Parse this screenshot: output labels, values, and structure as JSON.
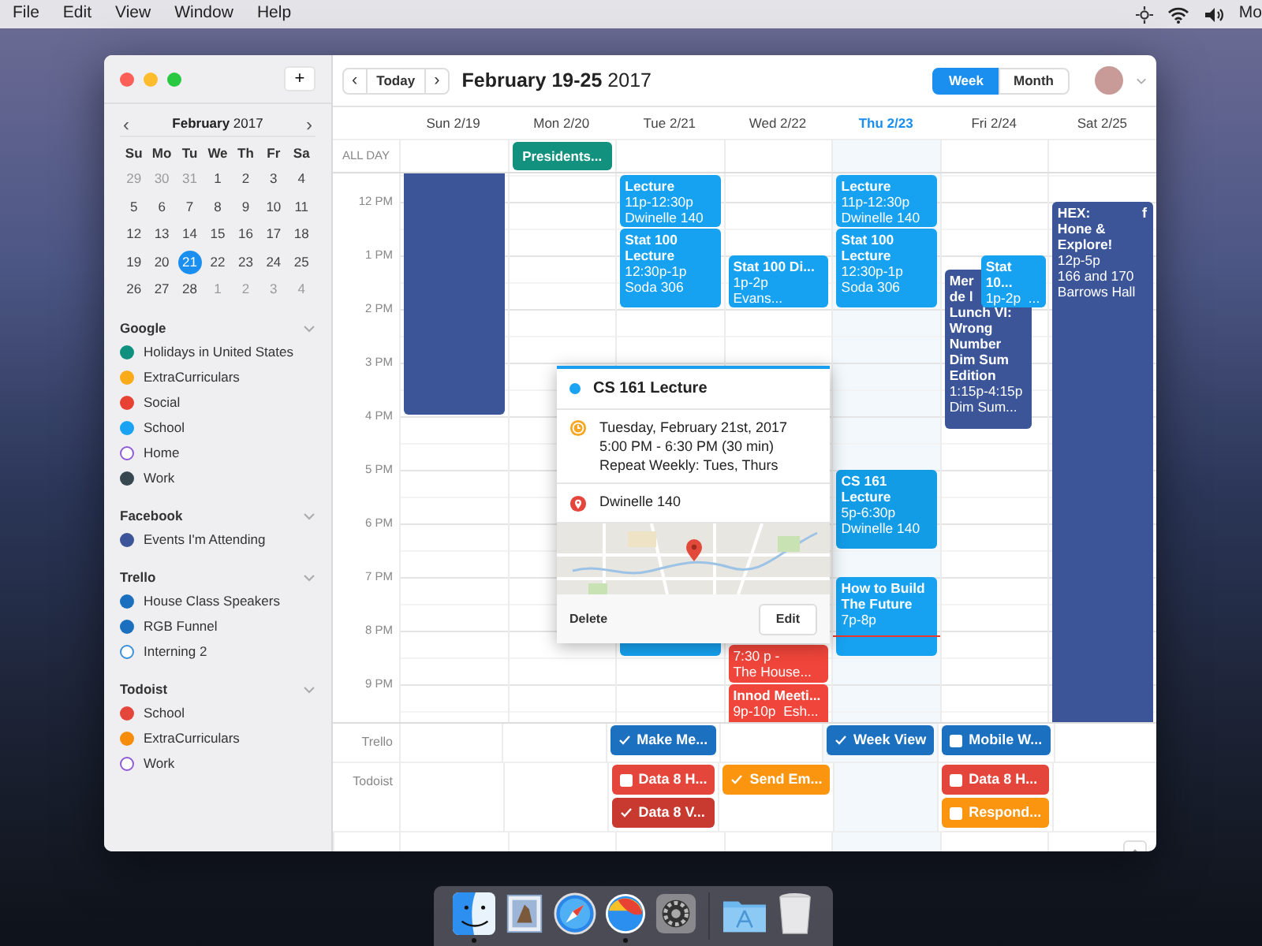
{
  "menu_bar": {
    "items": [
      "File",
      "Edit",
      "View",
      "Window",
      "Help"
    ],
    "status_text": "Mo"
  },
  "sidebar": {
    "add_button": "+",
    "mini_calendar": {
      "prev": "‹",
      "title": "**February** 2017",
      "next": "›",
      "weekdays": [
        "Su",
        "Mo",
        "Tu",
        "We",
        "Th",
        "Fr",
        "Sa"
      ],
      "weeks": [
        [
          {
            "day": "29",
            "muted": true,
            "selected": false
          },
          {
            "day": "30",
            "muted": true,
            "selected": false
          },
          {
            "day": "31",
            "muted": true,
            "selected": false
          },
          {
            "day": "1",
            "muted": false,
            "selected": false
          },
          {
            "day": "2",
            "muted": false,
            "selected": false
          },
          {
            "day": "3",
            "muted": false,
            "selected": false
          },
          {
            "day": "4",
            "muted": false,
            "selected": false
          }
        ],
        [
          {
            "day": "5",
            "muted": false,
            "selected": false
          },
          {
            "day": "6",
            "muted": false,
            "selected": false
          },
          {
            "day": "7",
            "muted": false,
            "selected": false
          },
          {
            "day": "8",
            "muted": false,
            "selected": false
          },
          {
            "day": "9",
            "muted": false,
            "selected": false
          },
          {
            "day": "10",
            "muted": false,
            "selected": false
          },
          {
            "day": "11",
            "muted": false,
            "selected": false
          }
        ],
        [
          {
            "day": "12",
            "muted": false,
            "selected": false
          },
          {
            "day": "13",
            "muted": false,
            "selected": false
          },
          {
            "day": "14",
            "muted": false,
            "selected": false
          },
          {
            "day": "15",
            "muted": false,
            "selected": false
          },
          {
            "day": "16",
            "muted": false,
            "selected": false
          },
          {
            "day": "17",
            "muted": false,
            "selected": false
          },
          {
            "day": "18",
            "muted": false,
            "selected": false
          }
        ],
        [
          {
            "day": "19",
            "muted": false,
            "selected": false
          },
          {
            "day": "20",
            "muted": false,
            "selected": false
          },
          {
            "day": "21",
            "muted": false,
            "selected": true
          },
          {
            "day": "22",
            "muted": false,
            "selected": false
          },
          {
            "day": "23",
            "muted": false,
            "selected": false
          },
          {
            "day": "24",
            "muted": false,
            "selected": false
          },
          {
            "day": "25",
            "muted": false,
            "selected": false
          }
        ],
        [
          {
            "day": "26",
            "muted": false,
            "selected": false
          },
          {
            "day": "27",
            "muted": false,
            "selected": false
          },
          {
            "day": "28",
            "muted": false,
            "selected": false
          },
          {
            "day": "1",
            "muted": true,
            "selected": false
          },
          {
            "day": "2",
            "muted": true,
            "selected": false
          },
          {
            "day": "3",
            "muted": true,
            "selected": false
          },
          {
            "day": "4",
            "muted": true,
            "selected": false
          }
        ]
      ]
    },
    "groups": [
      {
        "name": "Google",
        "expanded": true,
        "calendars": [
          {
            "name": "Holidays in United States",
            "color": "#10917f",
            "visible": true
          },
          {
            "name": "ExtraCurriculars",
            "color": "#f9ab1a",
            "visible": true
          },
          {
            "name": "Social",
            "color": "#e84235",
            "visible": true
          },
          {
            "name": "School",
            "color": "#1aa3f2",
            "visible": true
          },
          {
            "name": "Home",
            "color": "#8e5bd6",
            "visible": false
          },
          {
            "name": "Work",
            "color": "#37474f",
            "visible": true
          }
        ]
      },
      {
        "name": "Facebook",
        "expanded": true,
        "calendars": [
          {
            "name": "Events I'm Attending",
            "color": "#3b5598",
            "visible": true
          }
        ]
      },
      {
        "name": "Trello",
        "expanded": true,
        "calendars": [
          {
            "name": "House Class Speakers",
            "color": "#1b6fbf",
            "visible": true
          },
          {
            "name": "RGB Funnel",
            "color": "#1b6fbf",
            "visible": true
          },
          {
            "name": "Interning 2",
            "color": "#3a90d8",
            "visible": false
          }
        ]
      },
      {
        "name": "Todoist",
        "expanded": true,
        "calendars": [
          {
            "name": "School",
            "color": "#e5463c",
            "visible": true
          },
          {
            "name": "ExtraCurriculars",
            "color": "#f58c0a",
            "visible": true
          },
          {
            "name": "Work",
            "color": "#8e5bd6",
            "visible": false
          }
        ]
      }
    ]
  },
  "toolbar": {
    "prev": "‹",
    "today": "Today",
    "next": "›",
    "title": "**February 19-25** 2017",
    "views": [
      {
        "label": "Week",
        "selected": true
      },
      {
        "label": "Month",
        "selected": false
      }
    ]
  },
  "week": {
    "all_day_label": "ALL DAY",
    "hours": [
      "12 PM",
      "1 PM",
      "2 PM",
      "3 PM",
      "4 PM",
      "5 PM",
      "6 PM",
      "7 PM",
      "8 PM",
      "9 PM"
    ],
    "days": [
      {
        "label": "Sun 2/19",
        "today": false,
        "events": [
          {
            "color": "#3b5598"
          }
        ]
      },
      {
        "label": "Mon 2/20",
        "today": false,
        "all_day": [
          {
            "title": "Presidents...",
            "color": "#12917f"
          }
        ]
      },
      {
        "label": "Tue 2/21",
        "today": false,
        "events": [
          {
            "title": "Lecture",
            "details": [
              "11p-12:30p",
              "Dwinelle 140"
            ],
            "color": "#16a2f0"
          },
          {
            "title": "Stat 100 Lecture",
            "details": [
              "12:30p-1p",
              "Soda 306"
            ],
            "color": "#16a2f0"
          },
          {
            "color": "#16a2f0"
          }
        ],
        "tasks": [
          {
            "kind": "trello",
            "title": "Make Me...",
            "checked": true,
            "color": "#1b70c0"
          },
          {
            "kind": "todoist",
            "title": "Data 8 H...",
            "checked": false,
            "color": "#e5463c"
          },
          {
            "kind": "todoist",
            "title": "Data 8 V...",
            "checked": true,
            "color": "#c8392f"
          }
        ]
      },
      {
        "label": "Wed 2/22",
        "today": false,
        "events": [
          {
            "title": "Stat 100 Di...",
            "details": [
              "1p-2p  Evans..."
            ],
            "color": "#16a2f0"
          },
          {
            "details": [
              "7:30 p -",
              "The House..."
            ],
            "color": "#f0453a"
          },
          {
            "title": "Innod Meeti...",
            "details": [
              "9p-10p  Esh..."
            ],
            "color": "#f0453a"
          }
        ],
        "tasks": [
          {
            "kind": "todoist",
            "title": "Send Em...",
            "checked": true,
            "color": "#fb9510"
          }
        ]
      },
      {
        "label": "Thu 2/23",
        "today": true,
        "now_line": true,
        "events": [
          {
            "title": "Lecture",
            "details": [
              "11p-12:30p",
              "Dwinelle 140"
            ],
            "color": "#16a2f0"
          },
          {
            "title": "Stat 100 Lecture",
            "details": [
              "12:30p-1p",
              "Soda 306"
            ],
            "color": "#16a2f0"
          },
          {
            "title": "CS 161 Lecture",
            "details": [
              "5p-6:30p",
              "Dwinelle 140"
            ],
            "color": "#129ce6"
          },
          {
            "title": "How to Build The Future",
            "details": [
              "7p-8p"
            ],
            "color": "#16a2f0"
          }
        ],
        "tasks": [
          {
            "kind": "trello",
            "title": "Week View",
            "checked": true,
            "color": "#1b70c0"
          }
        ]
      },
      {
        "label": "Fri 2/24",
        "today": false,
        "events": [
          {
            "title": "Stat 10...",
            "details": [
              "1p-2p  ..."
            ],
            "color": "#16a2f0"
          },
          {
            "title_start": "Mer de l",
            "title": "Lunch VI: Wrong Number Dim Sum Edition",
            "details": [
              "1:15p-4:15p",
              "Dim Sum..."
            ],
            "color": "#3b5598"
          }
        ],
        "tasks": [
          {
            "kind": "trello",
            "title": "Mobile W...",
            "checked": false,
            "color": "#1b70c0"
          },
          {
            "kind": "todoist",
            "title": "Data 8 H...",
            "checked": false,
            "color": "#e5463c"
          },
          {
            "kind": "todoist",
            "title": "Respond...",
            "checked": false,
            "color": "#fb9510"
          }
        ]
      },
      {
        "label": "Sat 2/25",
        "today": false,
        "events": [
          {
            "title": "HEX: Hone & Explore!",
            "details": [
              "12p-5p",
              "166 and 170 Barrows Hall"
            ],
            "badge": "f",
            "color": "#3b5598"
          }
        ]
      }
    ]
  },
  "task_groups": [
    {
      "kind": "trello",
      "label": "Trello"
    },
    {
      "kind": "todoist",
      "label": "Todoist"
    }
  ],
  "popup": {
    "title": "CS 161 Lecture",
    "color": "#1aa3f2",
    "date": "Tuesday, February 21st, 2017",
    "time": "5:00 PM - 6:30 PM (30 min)",
    "repeat": "Repeat Weekly: Tues, Thurs",
    "location": "Dwinelle 140",
    "delete": "Delete",
    "edit": "Edit"
  },
  "dock": {
    "items": [
      {
        "kind": "finder",
        "running": true
      },
      {
        "kind": "mail",
        "running": false
      },
      {
        "kind": "safari",
        "running": false
      },
      {
        "kind": "app",
        "running": true
      },
      {
        "kind": "settings",
        "running": false
      },
      {
        "kind": "separator"
      },
      {
        "kind": "folder",
        "running": false
      },
      {
        "kind": "trash",
        "running": false
      }
    ]
  }
}
